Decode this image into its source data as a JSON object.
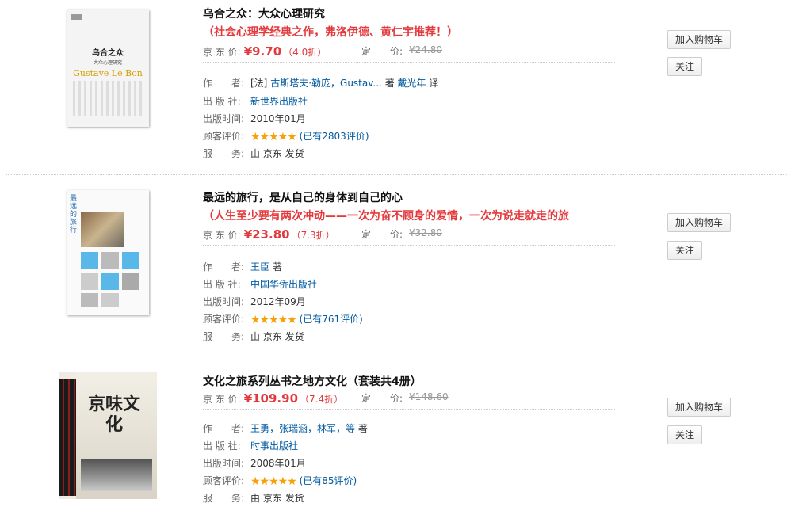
{
  "books": [
    {
      "title": "乌合之众：大众心理研究",
      "promo": "（社会心理学经典之作，弗洛伊德、黄仁宇推荐！）",
      "price_label": "京 东 价:",
      "price": "¥9.70",
      "discount": "（4.0折）",
      "list_label": "定　　价:",
      "list_price": "¥24.80",
      "author_label": "作　　者:",
      "author_prefix": "[法]",
      "authors": [
        "古斯塔夫·勒庞，Gustav...",
        "戴光年"
      ],
      "author_roles": [
        "著",
        "译"
      ],
      "publisher_label": "出 版 社:",
      "publisher": "新世界出版社",
      "date_label": "出版时间:",
      "date": "2010年01月",
      "rating_label": "顾客评价:",
      "rating": 5,
      "reviews": "(已有2803评价)",
      "service_label": "服　　务:",
      "service": "由 京东 发货",
      "cover": {
        "title": "乌合之众",
        "subtitle": "大众心理研究",
        "brand": "Gustave Le Bon"
      }
    },
    {
      "title": "最远的旅行，是从自己的身体到自己的心",
      "promo": "（人生至少要有两次冲动——一次为奋不顾身的爱情，一次为说走就走的旅",
      "price_label": "京 东 价:",
      "price": "¥23.80",
      "discount": "（7.3折）",
      "list_label": "定　　价:",
      "list_price": "¥32.80",
      "author_label": "作　　者:",
      "author_prefix": "",
      "authors": [
        "王臣"
      ],
      "author_roles": [
        "著"
      ],
      "publisher_label": "出 版 社:",
      "publisher": "中国华侨出版社",
      "date_label": "出版时间:",
      "date": "2012年09月",
      "rating_label": "顾客评价:",
      "rating": 5,
      "reviews": "(已有761评价)",
      "service_label": "服　　务:",
      "service": "由 京东 发货",
      "cover": {
        "title": "最远的旅行"
      }
    },
    {
      "title": "文化之旅系列丛书之地方文化（套装共4册）",
      "promo": "",
      "price_label": "京 东 价:",
      "price": "¥109.90",
      "discount": "（7.4折）",
      "list_label": "定　　价:",
      "list_price": "¥148.60",
      "author_label": "作　　者:",
      "author_prefix": "",
      "authors": [
        "王勇，张瑞涵，林军，等"
      ],
      "author_roles": [
        "著"
      ],
      "publisher_label": "出 版 社:",
      "publisher": "时事出版社",
      "date_label": "出版时间:",
      "date": "2008年01月",
      "rating_label": "顾客评价:",
      "rating": 5,
      "reviews": "(已有85评价)",
      "service_label": "服　　务:",
      "service": "由 京东 发货",
      "cover": {
        "title": "京味文化"
      }
    }
  ],
  "buttons": {
    "cart": "加入购物车",
    "follow": "关注"
  },
  "colors": {
    "price": "#e4393c",
    "link": "#005aa0",
    "star": "#f7a008"
  }
}
